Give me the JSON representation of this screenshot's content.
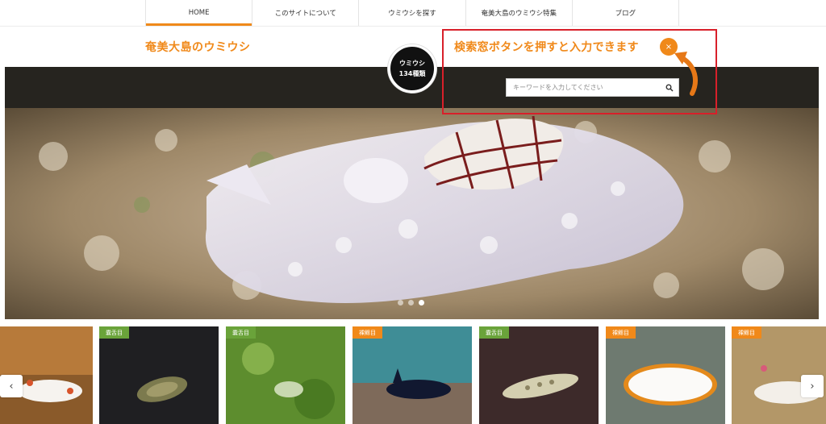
{
  "nav": {
    "items": [
      {
        "label": "HOME",
        "active": true
      },
      {
        "label": "このサイトについて"
      },
      {
        "label": "ウミウシを探す"
      },
      {
        "label": "奄美大島のウミウシ特集"
      },
      {
        "label": "ブログ"
      }
    ]
  },
  "header": {
    "site_title": "奄美大島のウミウシ",
    "count_line1": "ウミウシ",
    "count_line2": "134種類"
  },
  "search": {
    "placeholder": "キーワードを入力してください",
    "value": ""
  },
  "annotation": {
    "text": "検索窓ボタンを押すと入力できます",
    "close_label": "×"
  },
  "slider": {
    "dots": 3,
    "active_dot": 3
  },
  "thumbnails": [
    {
      "badge": "",
      "badge_color": "orange"
    },
    {
      "badge": "嚢舌目",
      "badge_color": "green"
    },
    {
      "badge": "嚢舌目",
      "badge_color": "green"
    },
    {
      "badge": "裸鰓目",
      "badge_color": "orange"
    },
    {
      "badge": "嚢舌目",
      "badge_color": "green"
    },
    {
      "badge": "裸鰓目",
      "badge_color": "orange"
    },
    {
      "badge": "裸鰓目",
      "badge_color": "orange"
    }
  ],
  "strip_arrows": {
    "prev": "‹",
    "next": "›"
  },
  "colors": {
    "accent": "#f0891a",
    "green": "#6aa33a",
    "annotation_red": "#d8202a"
  }
}
